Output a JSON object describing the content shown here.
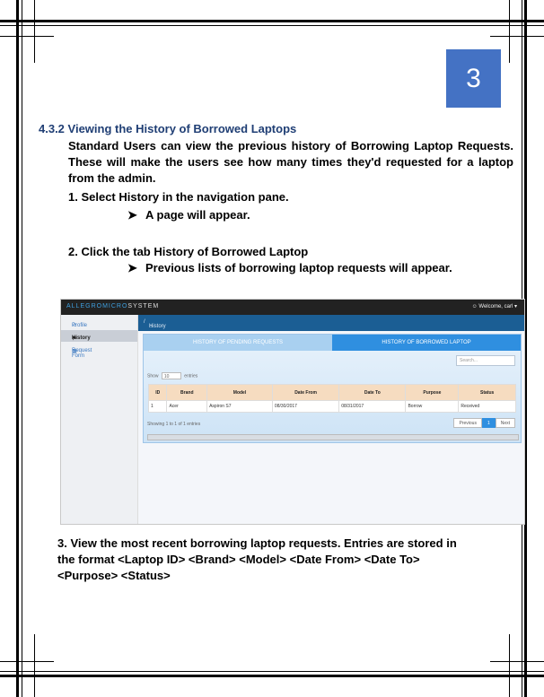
{
  "page_number": "3",
  "heading": "4.3.2 Viewing the History of Borrowed Laptops",
  "intro": "Standard Users can view the previous history of Borrowing Laptop Requests. These will make the users see how many times they'd requested for a laptop from the admin.",
  "step1": "1. Select History in the navigation pane.",
  "step1_result": "A page will appear.",
  "step2": "2. Click the tab History of Borrowed Laptop",
  "step2_result": "Previous lists of borrowing laptop requests will appear.",
  "screenshot": {
    "brand_a": "ALLEGROMICRO",
    "brand_b": "SYSTEM",
    "welcome": "Welcome, carl",
    "sidebar": [
      "Profile",
      "History",
      "Request Form"
    ],
    "breadcrumb": "History",
    "tab_pending": "HISTORY OF PENDING REQUESTS",
    "tab_borrowed": "HISTORY OF BORROWED LAPTOP",
    "search_placeholder": "Search...",
    "show_label": "Show",
    "show_value": "10",
    "entries_label": "entries",
    "columns": [
      "ID",
      "Brand",
      "Model",
      "Date From",
      "Date To",
      "Purpose",
      "Status"
    ],
    "row": [
      "1",
      "Acer",
      "Aspiron S7",
      "08/30/2017",
      "08/31/2017",
      "Borrow",
      "Received"
    ],
    "showing": "Showing 1 to 1 of 1 entries",
    "pager": [
      "Previous",
      "1",
      "Next"
    ]
  },
  "step3": "3. View the most recent borrowing laptop requests. Entries are stored in the format <Laptop ID> <Brand> <Model> <Date From> <Date To> <Purpose> <Status>"
}
